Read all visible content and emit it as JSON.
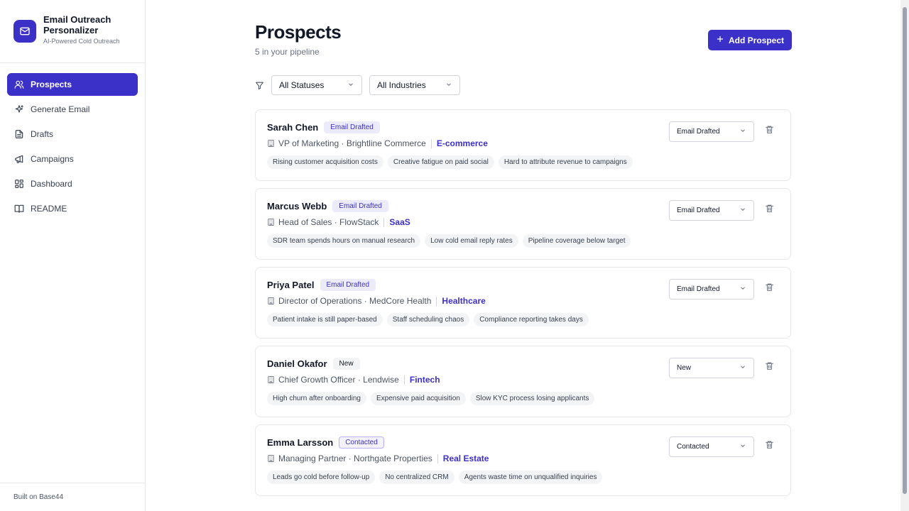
{
  "brand": {
    "title": "Email Outreach Personalizer",
    "subtitle": "AI-Powered Cold Outreach"
  },
  "nav": [
    {
      "label": "Prospects",
      "icon": "users-icon",
      "active": true
    },
    {
      "label": "Generate Email",
      "icon": "sparkles-icon"
    },
    {
      "label": "Drafts",
      "icon": "file-icon"
    },
    {
      "label": "Campaigns",
      "icon": "megaphone-icon"
    },
    {
      "label": "Dashboard",
      "icon": "grid-icon"
    },
    {
      "label": "README",
      "icon": "book-icon"
    }
  ],
  "footer": "Built on Base44",
  "header": {
    "title": "Prospects",
    "subtitle": "5 in your pipeline",
    "add_label": "Add Prospect"
  },
  "filters": {
    "status": "All Statuses",
    "industry": "All Industries"
  },
  "colors": {
    "accent": "#3b30c8",
    "badge_bg": "#ecebfb",
    "tag_bg": "#f3f4f6"
  },
  "prospects": [
    {
      "name": "Sarah Chen",
      "badge": "Email Drafted",
      "title": "VP of Marketing · Brightline Commerce",
      "industry": "E-commerce",
      "tags": [
        "Rising customer acquisition costs",
        "Creative fatigue on paid social",
        "Hard to attribute revenue to campaigns"
      ],
      "status": "Email Drafted"
    },
    {
      "name": "Marcus Webb",
      "badge": "Email Drafted",
      "title": "Head of Sales · FlowStack",
      "industry": "SaaS",
      "tags": [
        "SDR team spends hours on manual research",
        "Low cold email reply rates",
        "Pipeline coverage below target"
      ],
      "status": "Email Drafted"
    },
    {
      "name": "Priya Patel",
      "badge": "Email Drafted",
      "title": "Director of Operations · MedCore Health",
      "industry": "Healthcare",
      "tags": [
        "Patient intake is still paper-based",
        "Staff scheduling chaos",
        "Compliance reporting takes days"
      ],
      "status": "Email Drafted"
    },
    {
      "name": "Daniel Okafor",
      "badge": "New",
      "title": "Chief Growth Officer · Lendwise",
      "industry": "Fintech",
      "tags": [
        "High churn after onboarding",
        "Expensive paid acquisition",
        "Slow KYC process losing applicants"
      ],
      "status": "New"
    },
    {
      "name": "Emma Larsson",
      "badge": "Contacted",
      "title": "Managing Partner · Northgate Properties",
      "industry": "Real Estate",
      "tags": [
        "Leads go cold before follow-up",
        "No centralized CRM",
        "Agents waste time on unqualified inquiries"
      ],
      "status": "Contacted"
    }
  ]
}
